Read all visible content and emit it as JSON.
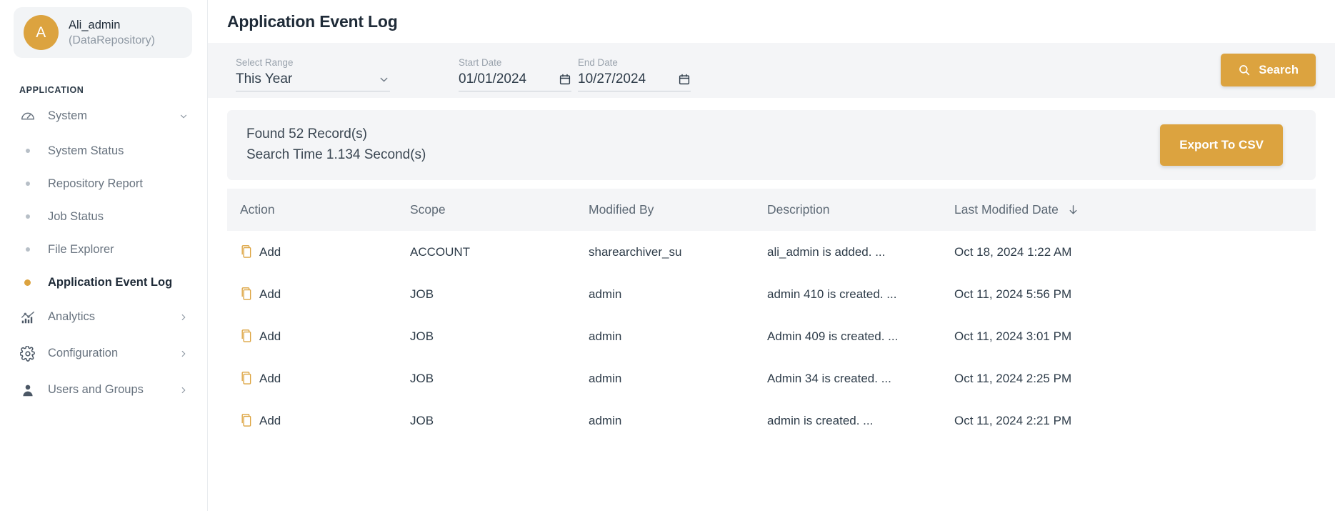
{
  "sidebar": {
    "user": {
      "avatar_initial": "A",
      "name": "Ali_admin",
      "subtitle": "(DataRepository)",
      "avatar_color": "#dca33f"
    },
    "section_title": "APPLICATION",
    "items": [
      {
        "label": "System",
        "icon": "gauge-icon",
        "chevron": "⌄",
        "expanded": true
      },
      {
        "label": "System Status",
        "type": "sub",
        "active": false
      },
      {
        "label": "Repository Report",
        "type": "sub",
        "active": false
      },
      {
        "label": "Job Status",
        "type": "sub",
        "active": false
      },
      {
        "label": "File Explorer",
        "type": "sub",
        "active": false
      },
      {
        "label": "Application Event Log",
        "type": "sub",
        "active": true
      },
      {
        "label": "Analytics",
        "icon": "bar-chart-icon",
        "chevron": "›"
      },
      {
        "label": "Configuration",
        "icon": "gear-icon",
        "chevron": "›"
      },
      {
        "label": "Users and Groups",
        "icon": "user-icon",
        "chevron": "›"
      }
    ]
  },
  "header": {
    "title": "Application Event Log"
  },
  "filters": {
    "range": {
      "label": "Select Range",
      "value": "This Year",
      "icon": "chevron-down-icon"
    },
    "start_date": {
      "label": "Start Date",
      "value": "01/01/2024",
      "icon": "calendar-icon"
    },
    "end_date": {
      "label": "End Date",
      "value": "10/27/2024",
      "icon": "calendar-icon"
    },
    "search_button": {
      "label": "Search",
      "icon": "search-icon",
      "color": "#dca33f"
    }
  },
  "results": {
    "found_text": "Found 52 Record(s)",
    "time_text": "Search Time 1.134 Second(s)",
    "export_button": {
      "label": "Export To CSV",
      "color": "#dca33f"
    }
  },
  "table": {
    "columns": [
      "Action",
      "Scope",
      "Modified By",
      "Description",
      "Last Modified Date"
    ],
    "sort_column": "Last Modified Date",
    "sort_icon": "↓",
    "rows": [
      {
        "action": "Add",
        "scope": "ACCOUNT",
        "modified_by": "sharearchiver_su",
        "description": "ali_admin is added. ...",
        "last_modified": "Oct 18, 2024 1:22 AM"
      },
      {
        "action": "Add",
        "scope": "JOB",
        "modified_by": "admin",
        "description": "admin 410 is created. ...",
        "last_modified": "Oct 11, 2024 5:56 PM"
      },
      {
        "action": "Add",
        "scope": "JOB",
        "modified_by": "admin",
        "description": "Admin 409 is created. ...",
        "last_modified": "Oct 11, 2024 3:01 PM"
      },
      {
        "action": "Add",
        "scope": "JOB",
        "modified_by": "admin",
        "description": "Admin 34 is created. ...",
        "last_modified": "Oct 11, 2024 2:25 PM"
      },
      {
        "action": "Add",
        "scope": "JOB",
        "modified_by": "admin",
        "description": "admin is created. ...",
        "last_modified": "Oct 11, 2024 2:21 PM"
      }
    ]
  }
}
